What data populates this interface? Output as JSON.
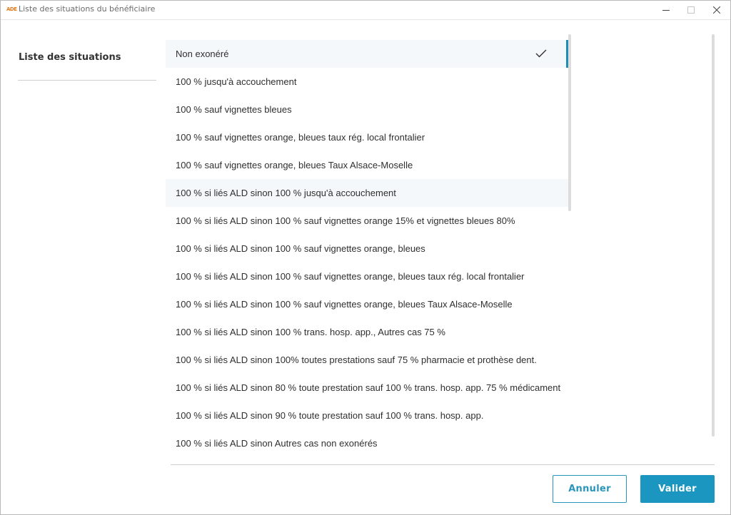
{
  "window": {
    "logo_text": "ADE",
    "title": "Liste des situations du bénéficiaire"
  },
  "sidebar": {
    "title": "Liste des situations"
  },
  "situations": [
    {
      "label": "Non exonéré",
      "selected": true
    },
    {
      "label": "100 % jusqu'à accouchement"
    },
    {
      "label": "100 % sauf vignettes bleues"
    },
    {
      "label": "100 % sauf vignettes orange, bleues taux rég. local frontalier"
    },
    {
      "label": "100 % sauf vignettes orange, bleues Taux Alsace-Moselle"
    },
    {
      "label": "100 % si liés ALD sinon 100 % jusqu'à accouchement",
      "hovered": true
    },
    {
      "label": "100 % si liés ALD sinon 100 % sauf vignettes orange 15% et vignettes bleues 80%"
    },
    {
      "label": "100 % si liés ALD sinon 100 % sauf vignettes orange, bleues"
    },
    {
      "label": "100 % si liés ALD sinon 100 % sauf vignettes orange, bleues taux rég. local frontalier"
    },
    {
      "label": "100 % si liés ALD sinon 100 % sauf vignettes orange, bleues Taux Alsace-Moselle"
    },
    {
      "label": "100 % si liés ALD sinon 100 % trans. hosp. app., Autres cas 75 %"
    },
    {
      "label": "100 % si liés ALD sinon 100% toutes prestations sauf 75 % pharmacie et prothèse dent."
    },
    {
      "label": "100 % si liés ALD sinon 80 % toute prestation sauf 100 % trans. hosp. app. 75 % médicament"
    },
    {
      "label": "100 % si liés ALD sinon 90 % toute prestation sauf 100 % trans. hosp. app."
    },
    {
      "label": "100 % si liés ALD sinon Autres cas non exonérés"
    }
  ],
  "footer": {
    "cancel_label": "Annuler",
    "validate_label": "Valider"
  },
  "colors": {
    "accent": "#1b96c1",
    "selected_bg": "#f5f8fa",
    "text": "#2f2f2f"
  }
}
